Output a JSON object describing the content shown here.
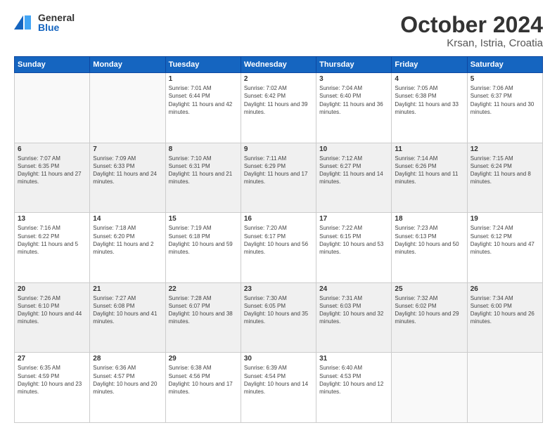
{
  "header": {
    "logo_general": "General",
    "logo_blue": "Blue",
    "title": "October 2024",
    "location": "Krsan, Istria, Croatia"
  },
  "columns": [
    "Sunday",
    "Monday",
    "Tuesday",
    "Wednesday",
    "Thursday",
    "Friday",
    "Saturday"
  ],
  "weeks": [
    [
      {
        "day": "",
        "info": ""
      },
      {
        "day": "",
        "info": ""
      },
      {
        "day": "1",
        "info": "Sunrise: 7:01 AM\nSunset: 6:44 PM\nDaylight: 11 hours and 42 minutes."
      },
      {
        "day": "2",
        "info": "Sunrise: 7:02 AM\nSunset: 6:42 PM\nDaylight: 11 hours and 39 minutes."
      },
      {
        "day": "3",
        "info": "Sunrise: 7:04 AM\nSunset: 6:40 PM\nDaylight: 11 hours and 36 minutes."
      },
      {
        "day": "4",
        "info": "Sunrise: 7:05 AM\nSunset: 6:38 PM\nDaylight: 11 hours and 33 minutes."
      },
      {
        "day": "5",
        "info": "Sunrise: 7:06 AM\nSunset: 6:37 PM\nDaylight: 11 hours and 30 minutes."
      }
    ],
    [
      {
        "day": "6",
        "info": "Sunrise: 7:07 AM\nSunset: 6:35 PM\nDaylight: 11 hours and 27 minutes."
      },
      {
        "day": "7",
        "info": "Sunrise: 7:09 AM\nSunset: 6:33 PM\nDaylight: 11 hours and 24 minutes."
      },
      {
        "day": "8",
        "info": "Sunrise: 7:10 AM\nSunset: 6:31 PM\nDaylight: 11 hours and 21 minutes."
      },
      {
        "day": "9",
        "info": "Sunrise: 7:11 AM\nSunset: 6:29 PM\nDaylight: 11 hours and 17 minutes."
      },
      {
        "day": "10",
        "info": "Sunrise: 7:12 AM\nSunset: 6:27 PM\nDaylight: 11 hours and 14 minutes."
      },
      {
        "day": "11",
        "info": "Sunrise: 7:14 AM\nSunset: 6:26 PM\nDaylight: 11 hours and 11 minutes."
      },
      {
        "day": "12",
        "info": "Sunrise: 7:15 AM\nSunset: 6:24 PM\nDaylight: 11 hours and 8 minutes."
      }
    ],
    [
      {
        "day": "13",
        "info": "Sunrise: 7:16 AM\nSunset: 6:22 PM\nDaylight: 11 hours and 5 minutes."
      },
      {
        "day": "14",
        "info": "Sunrise: 7:18 AM\nSunset: 6:20 PM\nDaylight: 11 hours and 2 minutes."
      },
      {
        "day": "15",
        "info": "Sunrise: 7:19 AM\nSunset: 6:18 PM\nDaylight: 10 hours and 59 minutes."
      },
      {
        "day": "16",
        "info": "Sunrise: 7:20 AM\nSunset: 6:17 PM\nDaylight: 10 hours and 56 minutes."
      },
      {
        "day": "17",
        "info": "Sunrise: 7:22 AM\nSunset: 6:15 PM\nDaylight: 10 hours and 53 minutes."
      },
      {
        "day": "18",
        "info": "Sunrise: 7:23 AM\nSunset: 6:13 PM\nDaylight: 10 hours and 50 minutes."
      },
      {
        "day": "19",
        "info": "Sunrise: 7:24 AM\nSunset: 6:12 PM\nDaylight: 10 hours and 47 minutes."
      }
    ],
    [
      {
        "day": "20",
        "info": "Sunrise: 7:26 AM\nSunset: 6:10 PM\nDaylight: 10 hours and 44 minutes."
      },
      {
        "day": "21",
        "info": "Sunrise: 7:27 AM\nSunset: 6:08 PM\nDaylight: 10 hours and 41 minutes."
      },
      {
        "day": "22",
        "info": "Sunrise: 7:28 AM\nSunset: 6:07 PM\nDaylight: 10 hours and 38 minutes."
      },
      {
        "day": "23",
        "info": "Sunrise: 7:30 AM\nSunset: 6:05 PM\nDaylight: 10 hours and 35 minutes."
      },
      {
        "day": "24",
        "info": "Sunrise: 7:31 AM\nSunset: 6:03 PM\nDaylight: 10 hours and 32 minutes."
      },
      {
        "day": "25",
        "info": "Sunrise: 7:32 AM\nSunset: 6:02 PM\nDaylight: 10 hours and 29 minutes."
      },
      {
        "day": "26",
        "info": "Sunrise: 7:34 AM\nSunset: 6:00 PM\nDaylight: 10 hours and 26 minutes."
      }
    ],
    [
      {
        "day": "27",
        "info": "Sunrise: 6:35 AM\nSunset: 4:59 PM\nDaylight: 10 hours and 23 minutes."
      },
      {
        "day": "28",
        "info": "Sunrise: 6:36 AM\nSunset: 4:57 PM\nDaylight: 10 hours and 20 minutes."
      },
      {
        "day": "29",
        "info": "Sunrise: 6:38 AM\nSunset: 4:56 PM\nDaylight: 10 hours and 17 minutes."
      },
      {
        "day": "30",
        "info": "Sunrise: 6:39 AM\nSunset: 4:54 PM\nDaylight: 10 hours and 14 minutes."
      },
      {
        "day": "31",
        "info": "Sunrise: 6:40 AM\nSunset: 4:53 PM\nDaylight: 10 hours and 12 minutes."
      },
      {
        "day": "",
        "info": ""
      },
      {
        "day": "",
        "info": ""
      }
    ]
  ]
}
